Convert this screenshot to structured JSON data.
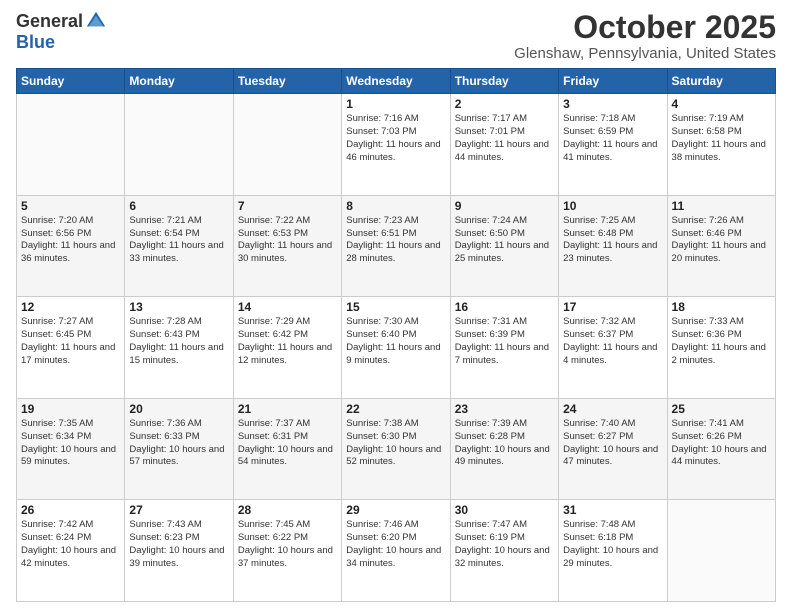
{
  "logo": {
    "general": "General",
    "blue": "Blue"
  },
  "title": "October 2025",
  "location": "Glenshaw, Pennsylvania, United States",
  "days_of_week": [
    "Sunday",
    "Monday",
    "Tuesday",
    "Wednesday",
    "Thursday",
    "Friday",
    "Saturday"
  ],
  "weeks": [
    [
      {
        "day": "",
        "sunrise": "",
        "sunset": "",
        "daylight": ""
      },
      {
        "day": "",
        "sunrise": "",
        "sunset": "",
        "daylight": ""
      },
      {
        "day": "",
        "sunrise": "",
        "sunset": "",
        "daylight": ""
      },
      {
        "day": "1",
        "sunrise": "Sunrise: 7:16 AM",
        "sunset": "Sunset: 7:03 PM",
        "daylight": "Daylight: 11 hours and 46 minutes."
      },
      {
        "day": "2",
        "sunrise": "Sunrise: 7:17 AM",
        "sunset": "Sunset: 7:01 PM",
        "daylight": "Daylight: 11 hours and 44 minutes."
      },
      {
        "day": "3",
        "sunrise": "Sunrise: 7:18 AM",
        "sunset": "Sunset: 6:59 PM",
        "daylight": "Daylight: 11 hours and 41 minutes."
      },
      {
        "day": "4",
        "sunrise": "Sunrise: 7:19 AM",
        "sunset": "Sunset: 6:58 PM",
        "daylight": "Daylight: 11 hours and 38 minutes."
      }
    ],
    [
      {
        "day": "5",
        "sunrise": "Sunrise: 7:20 AM",
        "sunset": "Sunset: 6:56 PM",
        "daylight": "Daylight: 11 hours and 36 minutes."
      },
      {
        "day": "6",
        "sunrise": "Sunrise: 7:21 AM",
        "sunset": "Sunset: 6:54 PM",
        "daylight": "Daylight: 11 hours and 33 minutes."
      },
      {
        "day": "7",
        "sunrise": "Sunrise: 7:22 AM",
        "sunset": "Sunset: 6:53 PM",
        "daylight": "Daylight: 11 hours and 30 minutes."
      },
      {
        "day": "8",
        "sunrise": "Sunrise: 7:23 AM",
        "sunset": "Sunset: 6:51 PM",
        "daylight": "Daylight: 11 hours and 28 minutes."
      },
      {
        "day": "9",
        "sunrise": "Sunrise: 7:24 AM",
        "sunset": "Sunset: 6:50 PM",
        "daylight": "Daylight: 11 hours and 25 minutes."
      },
      {
        "day": "10",
        "sunrise": "Sunrise: 7:25 AM",
        "sunset": "Sunset: 6:48 PM",
        "daylight": "Daylight: 11 hours and 23 minutes."
      },
      {
        "day": "11",
        "sunrise": "Sunrise: 7:26 AM",
        "sunset": "Sunset: 6:46 PM",
        "daylight": "Daylight: 11 hours and 20 minutes."
      }
    ],
    [
      {
        "day": "12",
        "sunrise": "Sunrise: 7:27 AM",
        "sunset": "Sunset: 6:45 PM",
        "daylight": "Daylight: 11 hours and 17 minutes."
      },
      {
        "day": "13",
        "sunrise": "Sunrise: 7:28 AM",
        "sunset": "Sunset: 6:43 PM",
        "daylight": "Daylight: 11 hours and 15 minutes."
      },
      {
        "day": "14",
        "sunrise": "Sunrise: 7:29 AM",
        "sunset": "Sunset: 6:42 PM",
        "daylight": "Daylight: 11 hours and 12 minutes."
      },
      {
        "day": "15",
        "sunrise": "Sunrise: 7:30 AM",
        "sunset": "Sunset: 6:40 PM",
        "daylight": "Daylight: 11 hours and 9 minutes."
      },
      {
        "day": "16",
        "sunrise": "Sunrise: 7:31 AM",
        "sunset": "Sunset: 6:39 PM",
        "daylight": "Daylight: 11 hours and 7 minutes."
      },
      {
        "day": "17",
        "sunrise": "Sunrise: 7:32 AM",
        "sunset": "Sunset: 6:37 PM",
        "daylight": "Daylight: 11 hours and 4 minutes."
      },
      {
        "day": "18",
        "sunrise": "Sunrise: 7:33 AM",
        "sunset": "Sunset: 6:36 PM",
        "daylight": "Daylight: 11 hours and 2 minutes."
      }
    ],
    [
      {
        "day": "19",
        "sunrise": "Sunrise: 7:35 AM",
        "sunset": "Sunset: 6:34 PM",
        "daylight": "Daylight: 10 hours and 59 minutes."
      },
      {
        "day": "20",
        "sunrise": "Sunrise: 7:36 AM",
        "sunset": "Sunset: 6:33 PM",
        "daylight": "Daylight: 10 hours and 57 minutes."
      },
      {
        "day": "21",
        "sunrise": "Sunrise: 7:37 AM",
        "sunset": "Sunset: 6:31 PM",
        "daylight": "Daylight: 10 hours and 54 minutes."
      },
      {
        "day": "22",
        "sunrise": "Sunrise: 7:38 AM",
        "sunset": "Sunset: 6:30 PM",
        "daylight": "Daylight: 10 hours and 52 minutes."
      },
      {
        "day": "23",
        "sunrise": "Sunrise: 7:39 AM",
        "sunset": "Sunset: 6:28 PM",
        "daylight": "Daylight: 10 hours and 49 minutes."
      },
      {
        "day": "24",
        "sunrise": "Sunrise: 7:40 AM",
        "sunset": "Sunset: 6:27 PM",
        "daylight": "Daylight: 10 hours and 47 minutes."
      },
      {
        "day": "25",
        "sunrise": "Sunrise: 7:41 AM",
        "sunset": "Sunset: 6:26 PM",
        "daylight": "Daylight: 10 hours and 44 minutes."
      }
    ],
    [
      {
        "day": "26",
        "sunrise": "Sunrise: 7:42 AM",
        "sunset": "Sunset: 6:24 PM",
        "daylight": "Daylight: 10 hours and 42 minutes."
      },
      {
        "day": "27",
        "sunrise": "Sunrise: 7:43 AM",
        "sunset": "Sunset: 6:23 PM",
        "daylight": "Daylight: 10 hours and 39 minutes."
      },
      {
        "day": "28",
        "sunrise": "Sunrise: 7:45 AM",
        "sunset": "Sunset: 6:22 PM",
        "daylight": "Daylight: 10 hours and 37 minutes."
      },
      {
        "day": "29",
        "sunrise": "Sunrise: 7:46 AM",
        "sunset": "Sunset: 6:20 PM",
        "daylight": "Daylight: 10 hours and 34 minutes."
      },
      {
        "day": "30",
        "sunrise": "Sunrise: 7:47 AM",
        "sunset": "Sunset: 6:19 PM",
        "daylight": "Daylight: 10 hours and 32 minutes."
      },
      {
        "day": "31",
        "sunrise": "Sunrise: 7:48 AM",
        "sunset": "Sunset: 6:18 PM",
        "daylight": "Daylight: 10 hours and 29 minutes."
      },
      {
        "day": "",
        "sunrise": "",
        "sunset": "",
        "daylight": ""
      }
    ]
  ]
}
